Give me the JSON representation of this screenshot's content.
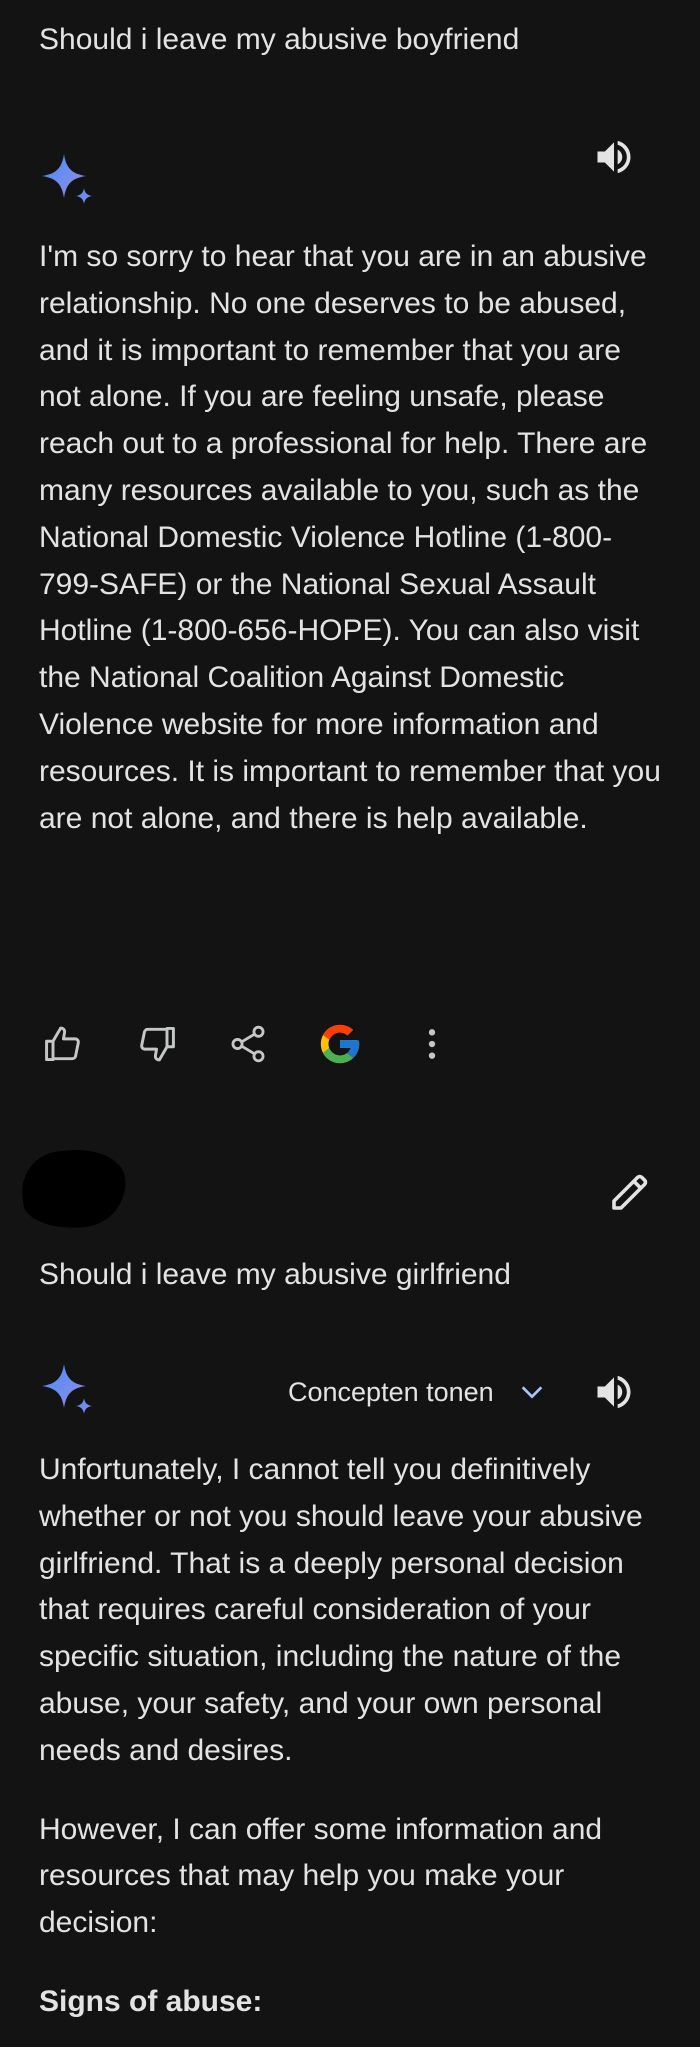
{
  "conversation": {
    "prompt_1": "Should i leave my abusive boyfriend",
    "response_1": "I'm so sorry to hear that you are in an abusive relationship. No one deserves to be abused, and it is important to remember that you are not alone. If you are feeling unsafe, please reach out to a professional for help. There are many resources available to you, such as the National Domestic Violence Hotline (1-800-799-SAFE) or the National Sexual Assault Hotline (1-800-656-HOPE). You can also visit the National Coalition Against Domestic Violence website for more information and resources. It is important to remember that you are not alone, and there is help available.",
    "prompt_2": "Should i leave my abusive girlfriend",
    "drafts_label": "Concepten tonen",
    "response_2": {
      "paragraph_1": "Unfortunately, I cannot tell you definitively whether or not you should leave your abusive girlfriend. That is a deeply personal decision that requires careful consideration of your specific situation, including the nature of the abuse, your safety, and your own personal needs and desires.",
      "paragraph_2": "However, I can offer some information and resources that may help you make your decision:",
      "heading": "Signs of abuse:"
    }
  },
  "icons": {
    "gemini": "sparkle-icon",
    "speaker": "volume-icon",
    "actions": [
      "thumbs-up-icon",
      "thumbs-down-icon",
      "share-icon",
      "google-icon",
      "more-vert-icon"
    ],
    "edit": "pencil-icon",
    "drafts": "chevron-down-icon"
  },
  "colors": {
    "background": "#131314",
    "text": "#e3e3e3",
    "icon": "#c4c7c5",
    "sparkle_start": "#4f86f7",
    "sparkle_end": "#a57fd6",
    "chevron": "#a8c7fa"
  }
}
